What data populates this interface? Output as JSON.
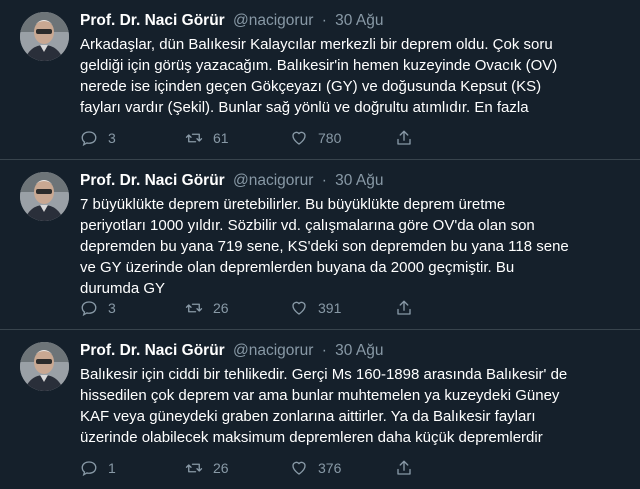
{
  "colors": {
    "background": "#15202b",
    "text": "#ffffff",
    "secondary": "#8899a6",
    "divider": "#38444d"
  },
  "tweets": [
    {
      "name": "Prof. Dr. Naci Görür",
      "handle": "@nacigorur",
      "separator": "·",
      "date": "30 Ağu",
      "lines": [
        "Arkadaşlar, dün Balıkesir Kalaycılar merkezli bir deprem oldu. Çok soru",
        "geldiği için görüş yazacağım. Balıkesir'in hemen kuzeyinde Ovacık (OV)",
        "nerede ise içinden geçen Gökçeyazı (GY) ve doğusunda Kepsut (KS)",
        "fayları vardır (Şekil). Bunlar sağ yönlü ve doğrultu atımlıdır. En fazla"
      ],
      "replies": "3",
      "retweets": "61",
      "likes": "780"
    },
    {
      "name": "Prof. Dr. Naci Görür",
      "handle": "@nacigorur",
      "separator": "·",
      "date": "30 Ağu",
      "lines": [
        "7 büyüklükte deprem üretebilirler. Bu büyüklükte deprem üretme",
        "periyotları 1000 yıldır. Sözbilir vd. çalışmalarına göre OV'da olan son",
        "depremden bu yana 719 sene, KS'deki son depremden bu yana 118 sene",
        "ve GY üzerinde olan depremlerden buyana da 2000 geçmiştir. Bu",
        "durumda GY"
      ],
      "replies": "3",
      "retweets": "26",
      "likes": "391"
    },
    {
      "name": "Prof. Dr. Naci Görür",
      "handle": "@nacigorur",
      "separator": "·",
      "date": "30 Ağu",
      "lines": [
        "Balıkesir için ciddi bir tehlikedir. Gerçi Ms 160-1898 arasında Balıkesir' de",
        "hissedilen çok deprem var ama bunlar muhtemelen ya kuzeydeki Güney",
        "KAF veya güneydeki graben zonlarına aittirler. Ya da Balıkesir fayları",
        "üzerinde olabilecek maksimum depremleren daha küçük depremlerdir"
      ],
      "replies": "1",
      "retweets": "26",
      "likes": "376"
    }
  ],
  "icons": {
    "reply": "reply-icon",
    "retweet": "retweet-icon",
    "like": "heart-icon",
    "share": "share-icon"
  }
}
